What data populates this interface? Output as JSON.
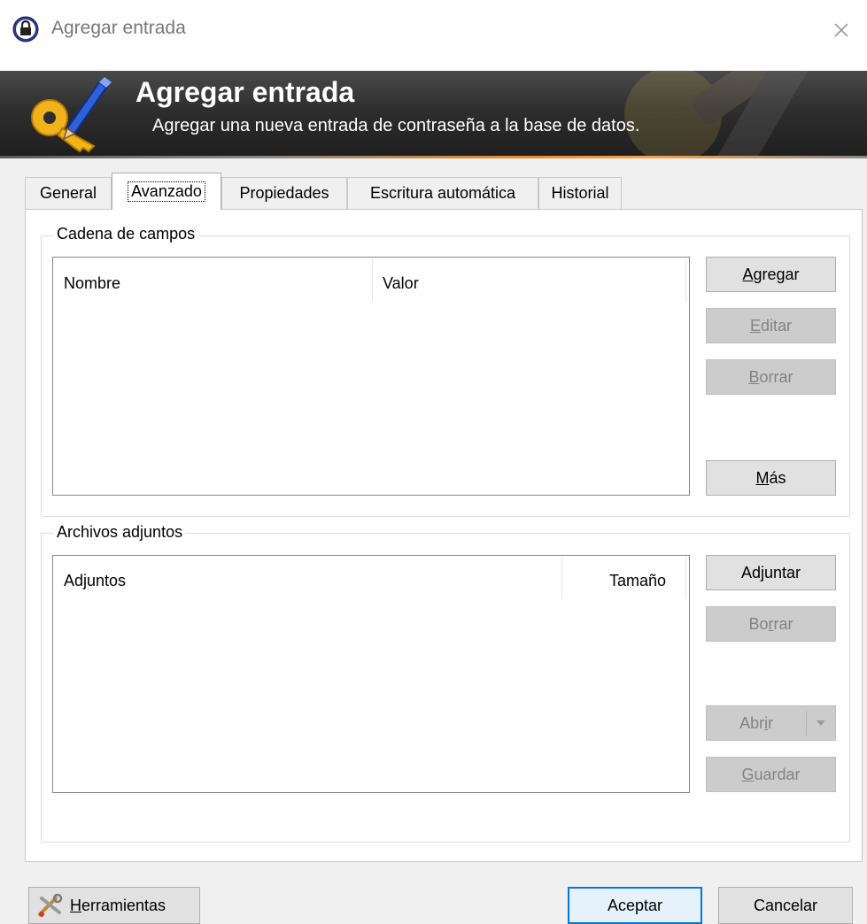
{
  "window": {
    "title": "Agregar entrada"
  },
  "banner": {
    "title": "Agregar entrada",
    "subtitle": "Agregar una nueva entrada de contraseña a la base de datos."
  },
  "tabs": [
    {
      "label": "General",
      "active": false
    },
    {
      "label": "Avanzado",
      "active": true
    },
    {
      "label": "Propiedades",
      "active": false
    },
    {
      "label": "Escritura automática",
      "active": false
    },
    {
      "label": "Historial",
      "active": false
    }
  ],
  "string_fields": {
    "group_label": "Cadena de campos",
    "columns": [
      "Nombre",
      "Valor"
    ],
    "buttons": {
      "add": {
        "pre": "",
        "ul": "A",
        "post": "gregar",
        "enabled": true
      },
      "edit": {
        "pre": "",
        "ul": "E",
        "post": "ditar",
        "enabled": false
      },
      "delete": {
        "pre": "",
        "ul": "B",
        "post": "orrar",
        "enabled": false
      },
      "more": {
        "pre": "",
        "ul": "M",
        "post": "ás",
        "enabled": true
      }
    }
  },
  "attachments": {
    "group_label": "Archivos adjuntos",
    "columns": [
      "Adjuntos",
      "Tamaño"
    ],
    "buttons": {
      "attach": {
        "pre": "Ad",
        "ul": "j",
        "post": "untar",
        "enabled": true
      },
      "delete": {
        "pre": "Bo",
        "ul": "r",
        "post": "rar",
        "enabled": false
      },
      "open": {
        "pre": "Abr",
        "ul": "i",
        "post": "r",
        "enabled": false
      },
      "save": {
        "pre": "",
        "ul": "G",
        "post": "uardar",
        "enabled": false
      }
    }
  },
  "footer": {
    "tools": {
      "pre": "",
      "ul": "H",
      "post": "erramientas"
    },
    "ok": "Aceptar",
    "cancel": "Cancelar"
  },
  "colors": {
    "accent": "#0078d7",
    "banner_stripe": "#ea8a2a"
  }
}
